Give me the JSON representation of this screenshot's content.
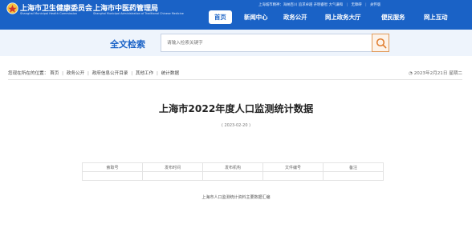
{
  "header": {
    "site_name_1": "上海市卫生健康委员会",
    "site_name_1_en": "Shanghai Municipal Health Commission",
    "site_name_2": "上海市中医药管理局",
    "site_name_2_en": "Shanghai Municipal Administration of Traditional Chinese Medicine",
    "top_links": [
      "上海城市精神：海纳百川 追求卓越 开明睿智 大气谦和",
      "无障碍",
      "关怀版"
    ],
    "nav": [
      "首页",
      "新闻中心",
      "政务公开",
      "网上政务大厅",
      "便民服务",
      "网上互动"
    ],
    "active_nav": "首页"
  },
  "search": {
    "title": "全文检索",
    "placeholder": "请输入检索关键字"
  },
  "breadcrumb": {
    "label": "您现在所在的位置：",
    "items": [
      "首页",
      "政务公开",
      "政府信息公开目录",
      "其他工作",
      "统计数据"
    ],
    "date": "2023年2月21日 星期二"
  },
  "article": {
    "title": "上海市2022年度人口监测统计数据",
    "date": "( 2023-02-20 )",
    "table_headers": [
      "索取号",
      "发布时间",
      "发布机构",
      "文件编号",
      "备注"
    ],
    "table_values": [
      "",
      "",
      "",
      "",
      ""
    ],
    "source": "上海市人口监测统计资料主要数据汇编"
  },
  "colors": {
    "header_blue": "#1a62c6",
    "search_bg": "#eef4fc",
    "search_btn_border": "#e09a5a"
  },
  "icons": {
    "logo": "health-commission-logo",
    "search": "search-icon"
  }
}
